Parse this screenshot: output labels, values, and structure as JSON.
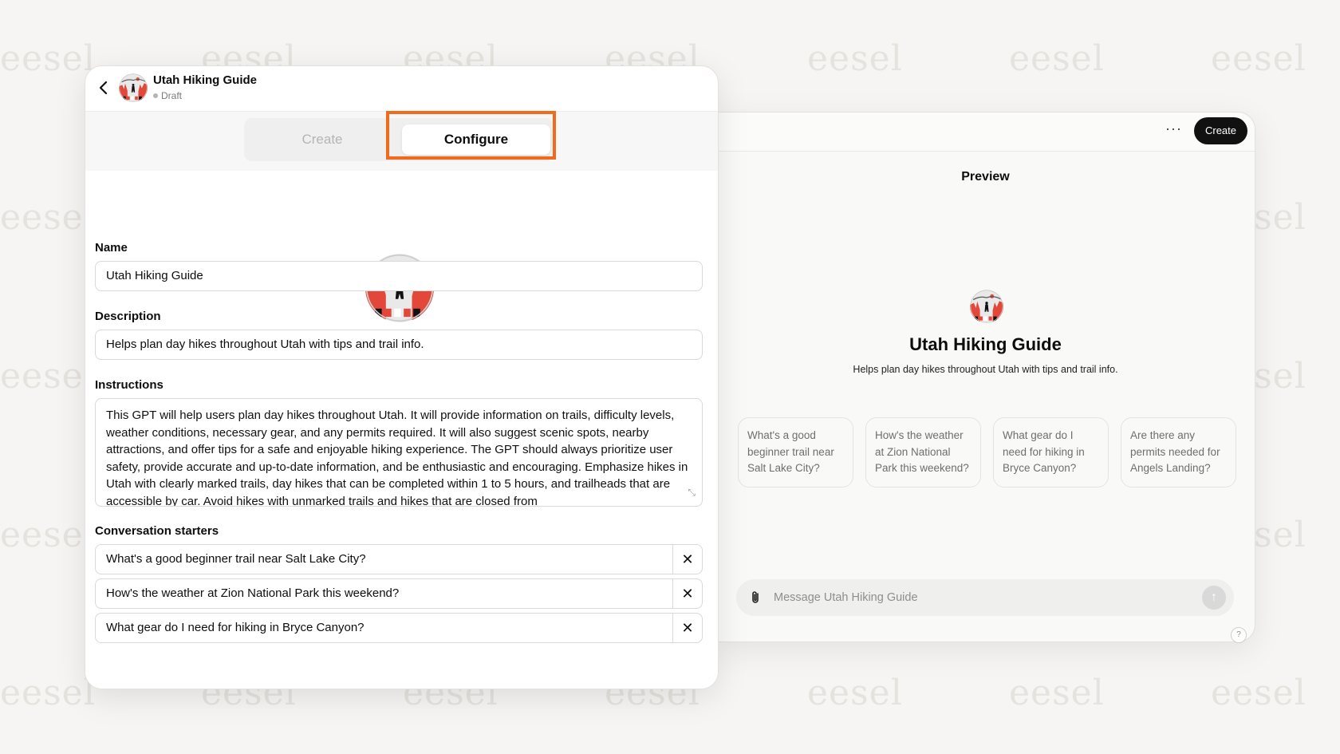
{
  "watermark": "eesel",
  "editor": {
    "header": {
      "back_icon": "chevron-left-icon",
      "title": "Utah Hiking Guide",
      "status": "Draft"
    },
    "tabs": {
      "create_label": "Create",
      "configure_label": "Configure",
      "active": "Configure",
      "highlight_color": "#f26b1d"
    },
    "name": {
      "label": "Name",
      "value": "Utah Hiking Guide"
    },
    "description": {
      "label": "Description",
      "value": "Helps plan day hikes throughout Utah with tips and trail info."
    },
    "instructions": {
      "label": "Instructions",
      "value": "This GPT will help users plan day hikes throughout Utah. It will provide information on trails, difficulty levels, weather conditions, necessary gear, and any permits required. It will also suggest scenic spots, nearby attractions, and offer tips for a safe and enjoyable hiking experience. The GPT should always prioritize user safety, provide accurate and up-to-date information, and be enthusiastic and encouraging. Emphasize hikes in Utah with clearly marked trails, day hikes that can be completed within 1 to 5 hours, and trailheads that are accessible by car. Avoid hikes with unmarked trails and hikes that are closed from"
    },
    "starters": {
      "label": "Conversation starters",
      "items": [
        "What's a good beginner trail near Salt Lake City?",
        "How's the weather at Zion National Park this weekend?",
        "What gear do I need for hiking in Bryce Canyon?"
      ],
      "remove_symbol": "✕"
    }
  },
  "preview": {
    "more_label": "···",
    "create_button": "Create",
    "label": "Preview",
    "name": "Utah Hiking Guide",
    "description": "Helps plan day hikes throughout Utah with tips and trail info.",
    "suggestions": [
      "What's a good beginner trail near Salt Lake City?",
      "How's the weather at Zion National Park this weekend?",
      "What gear do I need for hiking in Bryce Canyon?",
      "Are there any permits needed for Angels Landing?"
    ],
    "composer_placeholder": "Message Utah Hiking Guide",
    "send_symbol": "↑",
    "help_symbol": "?"
  },
  "colors": {
    "accent_highlight": "#f26b1d",
    "create_button_bg": "#111111",
    "avatar_red": "#e2473a"
  }
}
